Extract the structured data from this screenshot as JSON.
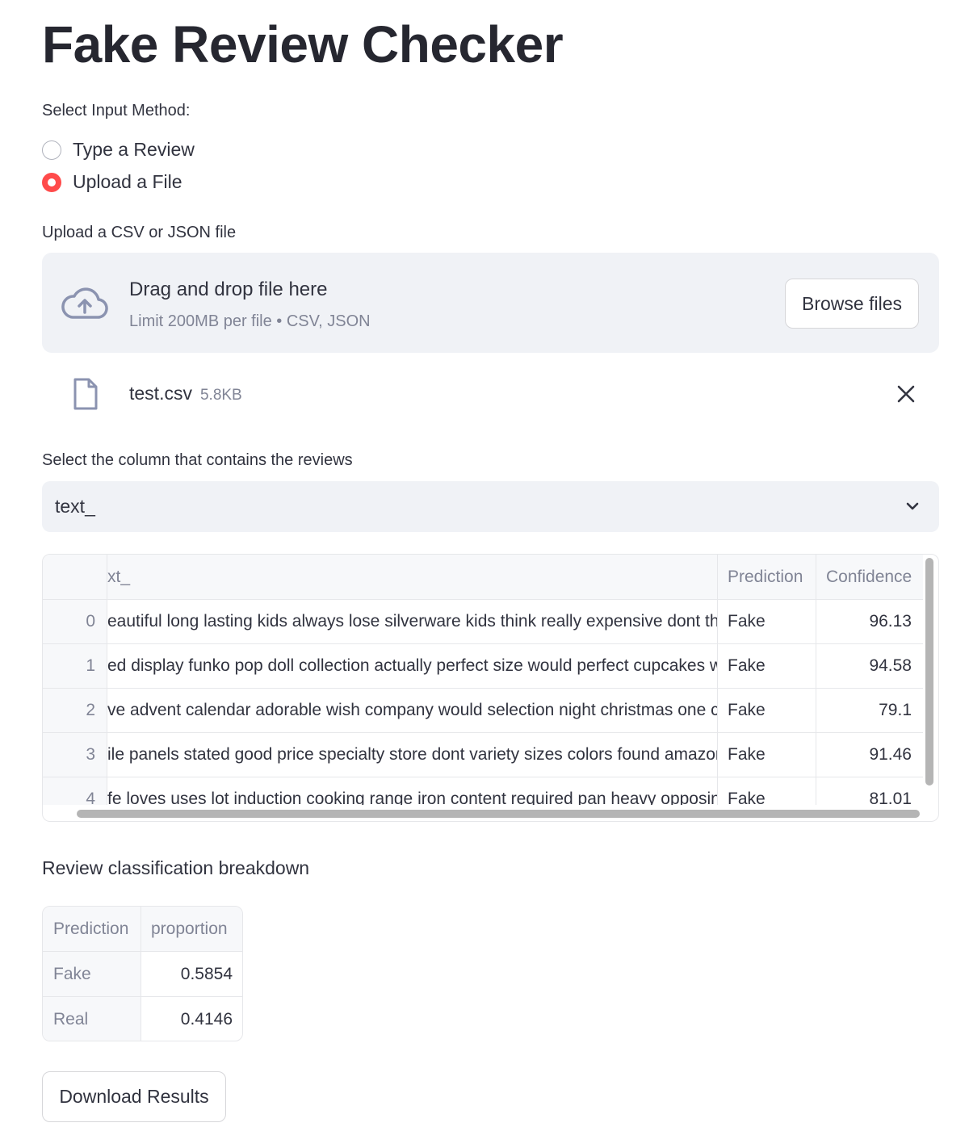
{
  "page": {
    "title": "Fake Review Checker"
  },
  "input_method": {
    "label": "Select Input Method:",
    "options": [
      {
        "label": "Type a Review",
        "selected": false
      },
      {
        "label": "Upload a File",
        "selected": true
      }
    ]
  },
  "uploader": {
    "label": "Upload a CSV or JSON file",
    "drop_title": "Drag and drop file here",
    "drop_subtitle": "Limit 200MB per file • CSV, JSON",
    "browse_label": "Browse files",
    "icon": "cloud-upload-icon",
    "file": {
      "name": "test.csv",
      "size": "5.8KB",
      "icon": "file-icon"
    }
  },
  "column_select": {
    "label": "Select the column that contains the reviews",
    "value": "text_",
    "icon": "chevron-down-icon"
  },
  "results_table": {
    "columns": [
      "xt_",
      "Prediction",
      "Confidence"
    ],
    "rows": [
      {
        "index": "0",
        "text": "eautiful long lasting kids always lose silverware kids think really expensive dont thr",
        "prediction": "Fake",
        "confidence": "96.13"
      },
      {
        "index": "1",
        "text": "ed display funko pop doll collection actually perfect size would perfect cupcakes w",
        "prediction": "Fake",
        "confidence": "94.58"
      },
      {
        "index": "2",
        "text": "ve advent calendar adorable wish company would selection night christmas one ca",
        "prediction": "Fake",
        "confidence": "79.1"
      },
      {
        "index": "3",
        "text": "ile panels stated good price specialty store dont variety sizes colors found amazon",
        "prediction": "Fake",
        "confidence": "91.46"
      },
      {
        "index": "4",
        "text": "fe loves uses lot induction cooking range iron content required pan heavy opposin",
        "prediction": "Fake",
        "confidence": "81.01"
      }
    ]
  },
  "breakdown": {
    "label": "Review classification breakdown",
    "columns": [
      "Prediction",
      "proportion"
    ],
    "rows": [
      {
        "prediction": "Fake",
        "proportion": "0.5854"
      },
      {
        "prediction": "Real",
        "proportion": "0.4146"
      }
    ]
  },
  "download": {
    "label": "Download Results"
  },
  "colors": {
    "accent": "#ff4b4b",
    "text": "#31333f",
    "muted": "#808495",
    "panel": "#f0f2f6"
  }
}
